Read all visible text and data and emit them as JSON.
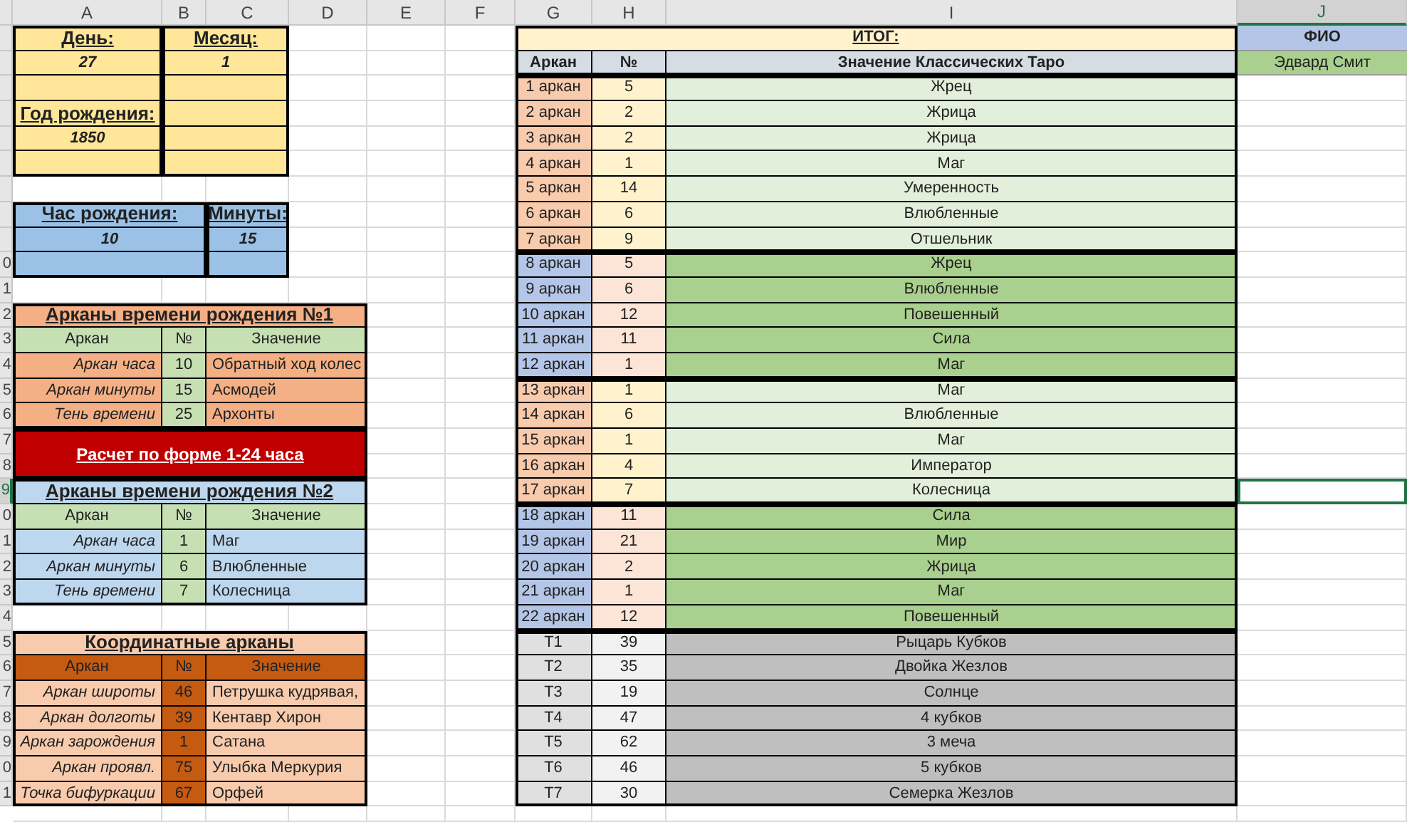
{
  "columns": [
    {
      "label": "A",
      "selected": false
    },
    {
      "label": "B",
      "selected": false
    },
    {
      "label": "C",
      "selected": false
    },
    {
      "label": "D",
      "selected": false
    },
    {
      "label": "E",
      "selected": false
    },
    {
      "label": "F",
      "selected": false
    },
    {
      "label": "G",
      "selected": false
    },
    {
      "label": "H",
      "selected": false
    },
    {
      "label": "I",
      "selected": false
    },
    {
      "label": "J",
      "selected": true
    }
  ],
  "row_numbers": [
    {
      "label": "0",
      "selected": false
    },
    {
      "label": "1",
      "selected": false
    },
    {
      "label": "2",
      "selected": false
    },
    {
      "label": "3",
      "selected": false
    },
    {
      "label": "4",
      "selected": false
    },
    {
      "label": "5",
      "selected": false
    },
    {
      "label": "6",
      "selected": false
    },
    {
      "label": "7",
      "selected": false
    },
    {
      "label": "8",
      "selected": false
    },
    {
      "label": "9",
      "selected": true
    },
    {
      "label": "0",
      "selected": false
    },
    {
      "label": "1",
      "selected": false
    },
    {
      "label": "2",
      "selected": false
    },
    {
      "label": "3",
      "selected": false
    },
    {
      "label": "4",
      "selected": false
    },
    {
      "label": "5",
      "selected": false
    },
    {
      "label": "6",
      "selected": false
    },
    {
      "label": "7",
      "selected": false
    },
    {
      "label": "8",
      "selected": false
    },
    {
      "label": "9",
      "selected": false
    },
    {
      "label": "0",
      "selected": false
    },
    {
      "label": "1",
      "selected": false
    }
  ],
  "birth_date": {
    "day_label": "День:",
    "day": "27",
    "month_label": "Месяц:",
    "month": "1",
    "year_label": "Год рождения:",
    "year": "1850"
  },
  "birth_time": {
    "hour_label": "Час рождения:",
    "hour": "10",
    "minutes_label": "Минуты:",
    "minutes": "15"
  },
  "time_arcana_1": {
    "title": "Арканы времени рождения №1",
    "columns": [
      "Аркан",
      "№",
      "Значение"
    ],
    "rows": [
      [
        "Аркан часа",
        "10",
        "Обратный ход колес"
      ],
      [
        "Аркан минуты",
        "15",
        "Асмодей"
      ],
      [
        "Тень времени",
        "25",
        "Архонты"
      ]
    ]
  },
  "calc_banner": "Расчет по форме 1-24 часа",
  "time_arcana_2": {
    "title": "Арканы времени рождения №2",
    "columns": [
      "Аркан",
      "№",
      "Значение"
    ],
    "rows": [
      [
        "Аркан часа",
        "1",
        "Маг"
      ],
      [
        "Аркан минуты",
        "6",
        "Влюбленные"
      ],
      [
        "Тень времени",
        "7",
        "Колесница"
      ]
    ]
  },
  "coordinate_arcana": {
    "title": "Координатные арканы",
    "columns": [
      "Аркан",
      "№",
      "Значение"
    ],
    "rows": [
      [
        "Аркан широты",
        "46",
        "Петрушка кудрявая,"
      ],
      [
        "Аркан долготы",
        "39",
        "Кентавр Хирон"
      ],
      [
        "Аркан зарождения",
        "1",
        "Сатана"
      ],
      [
        "Аркан проявл.",
        "75",
        "Улыбка Меркурия"
      ],
      [
        "Точка бифуркации",
        "67",
        "Орфей"
      ]
    ]
  },
  "summary": {
    "title": "ИТОГ:",
    "columns": [
      "Аркан",
      "№",
      "Значение Классических Таро"
    ],
    "groups": [
      {
        "kind": "primary",
        "rows": [
          [
            "1 аркан",
            "5",
            "Жрец"
          ],
          [
            "2 аркан",
            "2",
            "Жрица"
          ],
          [
            "3 аркан",
            "2",
            "Жрица"
          ],
          [
            "4 аркан",
            "1",
            "Маг"
          ],
          [
            "5 аркан",
            "14",
            "Умеренность"
          ],
          [
            "6 аркан",
            "6",
            "Влюбленные"
          ],
          [
            "7 аркан",
            "9",
            "Отшельник"
          ]
        ]
      },
      {
        "kind": "secondary",
        "rows": [
          [
            "8 аркан",
            "5",
            "Жрец"
          ],
          [
            "9 аркан",
            "6",
            "Влюбленные"
          ],
          [
            "10 аркан",
            "12",
            "Повешенный"
          ],
          [
            "11 аркан",
            "11",
            "Сила"
          ],
          [
            "12 аркан",
            "1",
            "Маг"
          ]
        ]
      },
      {
        "kind": "primary",
        "rows": [
          [
            "13 аркан",
            "1",
            "Маг"
          ],
          [
            "14 аркан",
            "6",
            "Влюбленные"
          ],
          [
            "15 аркан",
            "1",
            "Маг"
          ],
          [
            "16 аркан",
            "4",
            "Император"
          ],
          [
            "17 аркан",
            "7",
            "Колесница"
          ]
        ]
      },
      {
        "kind": "secondary",
        "rows": [
          [
            "18 аркан",
            "11",
            "Сила"
          ],
          [
            "19 аркан",
            "21",
            "Мир"
          ],
          [
            "20 аркан",
            "2",
            "Жрица"
          ],
          [
            "21 аркан",
            "1",
            "Маг"
          ],
          [
            "22 аркан",
            "12",
            "Повешенный"
          ]
        ]
      },
      {
        "kind": "minor",
        "rows": [
          [
            "T1",
            "39",
            "Рыцарь Кубков"
          ],
          [
            "T2",
            "35",
            "Двойка Жезлов"
          ],
          [
            "T3",
            "19",
            "Солнце"
          ],
          [
            "T4",
            "47",
            "4 кубков"
          ],
          [
            "T5",
            "62",
            "3 меча"
          ],
          [
            "T6",
            "46",
            "5 кубков"
          ],
          [
            "T7",
            "30",
            "Семерка Жезлов"
          ]
        ]
      }
    ]
  },
  "fio": {
    "label": "ФИО",
    "value": "Эдвард Смит"
  }
}
